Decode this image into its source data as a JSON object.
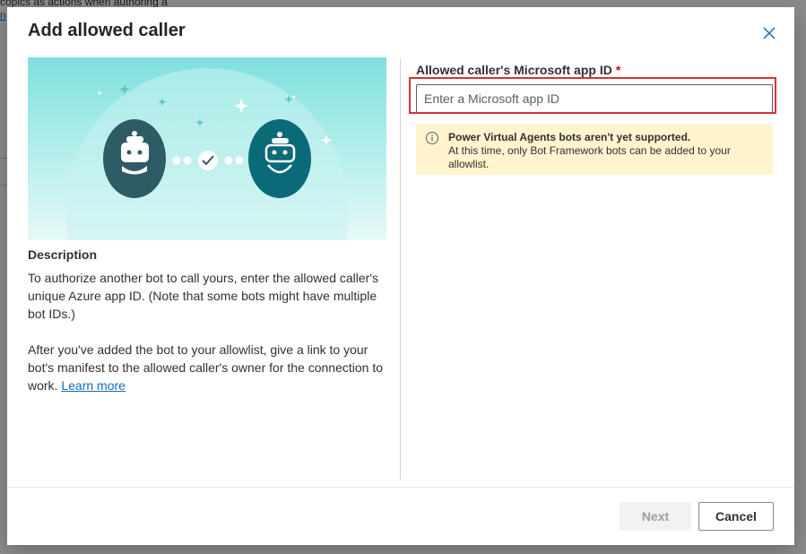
{
  "background": {
    "fragment_top": "copics as actions when authoring a",
    "fragment_link": "n"
  },
  "dialog": {
    "title": "Add allowed caller",
    "close_icon": "close-icon"
  },
  "description": {
    "heading": "Description",
    "paragraph1": "To authorize another bot to call yours, enter the allowed caller's unique Azure app ID. (Note that some bots might have multiple bot IDs.)",
    "paragraph2": "After you've added the bot to your allowlist, give a link to your bot's manifest to the allowed caller's owner for the connection to work.",
    "learn_more": "Learn more"
  },
  "field": {
    "label": "Allowed caller's Microsoft app ID",
    "required_marker": "*",
    "placeholder": "Enter a Microsoft app ID",
    "value": ""
  },
  "warning": {
    "icon": "info-icon",
    "title": "Power Virtual Agents bots aren't yet supported.",
    "body": "At this time, only Bot Framework bots can be added to your allowlist."
  },
  "footer": {
    "next_label": "Next",
    "cancel_label": "Cancel"
  },
  "colors": {
    "accent": "#0f6cbd",
    "highlight": "#d13438",
    "warning_bg": "#fff4ce",
    "bot_dark": "#2f5b66",
    "bot_teal": "#0b6a77"
  }
}
